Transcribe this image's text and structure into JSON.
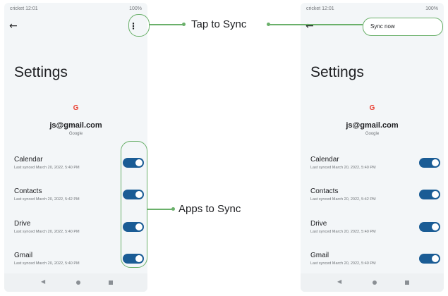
{
  "status": {
    "carrier_time": "cricket 12:01",
    "battery": "100%"
  },
  "settings": {
    "title": "Settings",
    "google_logo": "G",
    "email": "js@gmail.com",
    "provider": "Google",
    "items": [
      {
        "name": "Calendar",
        "last_synced": "Last synced March 20, 2022, 5:40 PM"
      },
      {
        "name": "Contacts",
        "last_synced": "Last synced March 20, 2022, 5:42 PM"
      },
      {
        "name": "Drive",
        "last_synced": "Last synced March 20, 2022, 5:40 PM"
      },
      {
        "name": "Gmail",
        "last_synced": "Last synced March 20, 2022, 5:40 PM"
      }
    ]
  },
  "menu": {
    "sync_now": "Sync now"
  },
  "callouts": {
    "tap_to_sync": "Tap to Sync",
    "apps_to_sync": "Apps to Sync"
  },
  "icons": [
    "back-arrow-icon",
    "overflow-menu-icon",
    "google-icon",
    "nav-back-icon",
    "nav-home-icon",
    "nav-recents-icon"
  ],
  "colors": {
    "accent": "#1a5c95",
    "highlight": "#6ab06a",
    "screen_bg": "#f3f6f8"
  }
}
